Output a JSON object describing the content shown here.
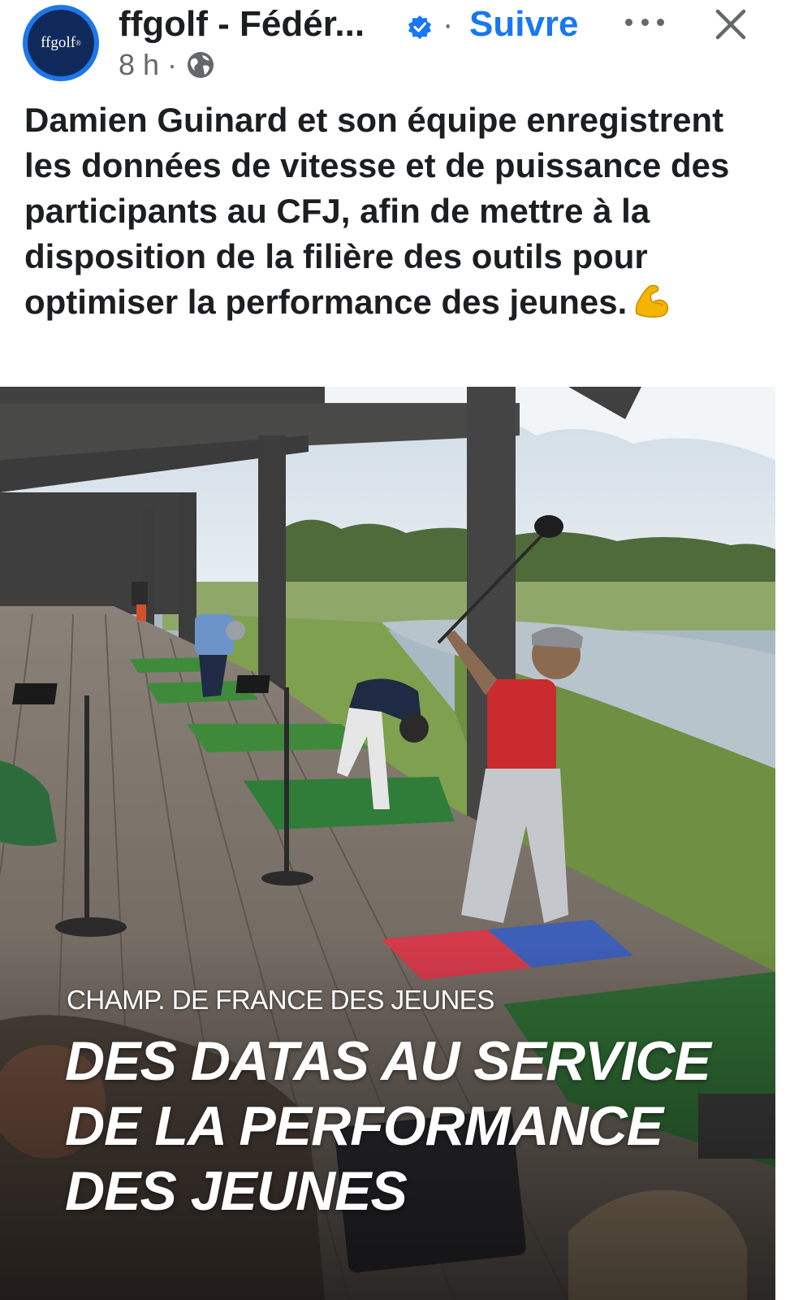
{
  "post": {
    "page_name": "ffgolf - Fédér...",
    "follow_label": "Suivre",
    "dot_separator": "·",
    "time": "8 h",
    "meta_separator": "·",
    "avatar_text": "ffgolf",
    "avatar_mark": "®",
    "caption": "Damien Guinard et son équipe enregistrent les données de vitesse et de puissance des participants au CFJ, afin de mettre à la disposition de la filière des outils pour optimiser la performance des jeunes."
  },
  "icons": {
    "verified": "verified-badge-icon",
    "audience": "globe-icon",
    "more": "more-options-icon",
    "close": "close-icon",
    "emoji": "flexed-biceps-emoji"
  },
  "image": {
    "subtitle": "CHAMP. DE FRANCE DES JEUNES",
    "title_lines": [
      "DES DATAS AU SERVICE",
      "DE LA PERFORMANCE",
      "DES JEUNES"
    ]
  },
  "colors": {
    "accent": "#1877f2",
    "text": "#1c1e21",
    "muted": "#65676b"
  }
}
